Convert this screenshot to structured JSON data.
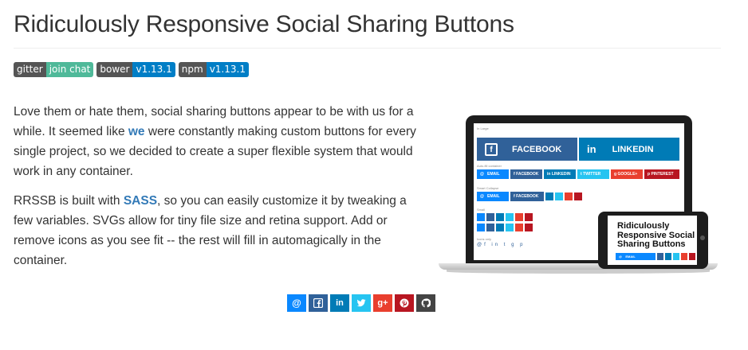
{
  "page": {
    "title": "Ridiculously Responsive Social Sharing Buttons"
  },
  "badges": [
    {
      "left": "gitter",
      "right": "join chat",
      "color": "#4fb999"
    },
    {
      "left": "bower",
      "right": "v1.13.1",
      "color": "#007ec6"
    },
    {
      "left": "npm",
      "right": "v1.13.1",
      "color": "#007ec6"
    }
  ],
  "intro": {
    "p1_before": "Love them or hate them, social sharing buttons appear to be with us for a while. It seemed like ",
    "p1_link": "we",
    "p1_after": " were constantly making custom buttons for every single project, so we decided to create a super flexible system that would work in any container.",
    "p2_before": "RRSSB is built with ",
    "p2_link": "SASS",
    "p2_after": ", so you can easily customize it by tweaking a few variables. SVGs allow for tiny file size and retina support. Add or remove icons as you see fit -- the rest will fill in automagically in the container."
  },
  "illustration": {
    "labels": {
      "large": "In Large",
      "autofill": "Auto-fill container",
      "smart": "Smart Collapse",
      "small": "Small",
      "icons": "Icons only"
    },
    "big_facebook": "FACEBOOK",
    "big_linkedin": "LINKEDIN",
    "row_email": "EMAIL",
    "row_facebook": "FACEBOOK",
    "row_linkedin": "LINKEDIN",
    "row_twitter": "TWITTER",
    "row_google": "GOOGLE+",
    "row_pinterest": "PINTEREST",
    "phone_title": "Ridiculously Responsive Social Sharing Buttons",
    "phone_email": "EMAIL"
  },
  "share_buttons": [
    {
      "name": "email-share-button",
      "icon": "at-icon",
      "glyph": "@",
      "color": "#0a88ff"
    },
    {
      "name": "facebook-share-button",
      "icon": "facebook-icon",
      "glyph": "f",
      "color": "#306199"
    },
    {
      "name": "linkedin-share-button",
      "icon": "linkedin-icon",
      "glyph": "in",
      "color": "#007bb6"
    },
    {
      "name": "twitter-share-button",
      "icon": "twitter-icon",
      "glyph": "t",
      "color": "#26c4f1"
    },
    {
      "name": "googleplus-share-button",
      "icon": "googleplus-icon",
      "glyph": "g+",
      "color": "#e93f2e"
    },
    {
      "name": "pinterest-share-button",
      "icon": "pinterest-icon",
      "glyph": "p",
      "color": "#b81621"
    },
    {
      "name": "github-share-button",
      "icon": "github-icon",
      "glyph": "gh",
      "color": "#444"
    }
  ]
}
